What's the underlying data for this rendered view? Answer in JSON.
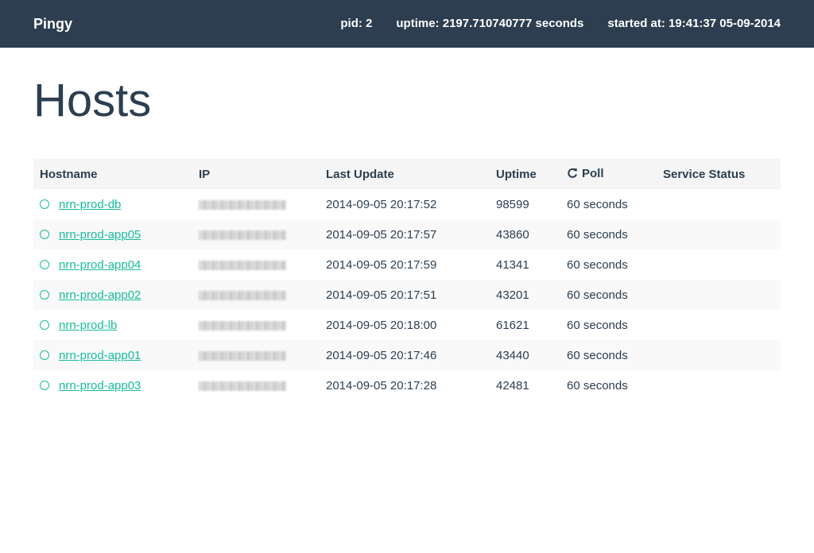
{
  "navbar": {
    "brand": "Pingy",
    "pid": "pid: 2",
    "uptime": "uptime: 2197.710740777 seconds",
    "started_at": "started at: 19:41:37 05-09-2014"
  },
  "page": {
    "title": "Hosts"
  },
  "table": {
    "headers": {
      "hostname": "Hostname",
      "ip": "IP",
      "last_update": "Last Update",
      "uptime": "Uptime",
      "poll": "Poll",
      "service_status": "Service Status"
    },
    "rows": [
      {
        "hostname": "nrn-prod-db",
        "last_update": "2014-09-05 20:17:52",
        "uptime": "98599",
        "poll": "60 seconds"
      },
      {
        "hostname": "nrn-prod-app05",
        "last_update": "2014-09-05 20:17:57",
        "uptime": "43860",
        "poll": "60 seconds"
      },
      {
        "hostname": "nrn-prod-app04",
        "last_update": "2014-09-05 20:17:59",
        "uptime": "41341",
        "poll": "60 seconds"
      },
      {
        "hostname": "nrn-prod-app02",
        "last_update": "2014-09-05 20:17:51",
        "uptime": "43201",
        "poll": "60 seconds"
      },
      {
        "hostname": "nrn-prod-lb",
        "last_update": "2014-09-05 20:18:00",
        "uptime": "61621",
        "poll": "60 seconds"
      },
      {
        "hostname": "nrn-prod-app01",
        "last_update": "2014-09-05 20:17:46",
        "uptime": "43440",
        "poll": "60 seconds"
      },
      {
        "hostname": "nrn-prod-app03",
        "last_update": "2014-09-05 20:17:28",
        "uptime": "42481",
        "poll": "60 seconds"
      }
    ]
  },
  "colors": {
    "navbar_bg": "#2c3e50",
    "link": "#18bc9c",
    "text": "#2c3e50",
    "header_row_bg": "#f5f5f5"
  },
  "icons": {
    "status": "status-circle-icon",
    "poll": "refresh-icon"
  }
}
